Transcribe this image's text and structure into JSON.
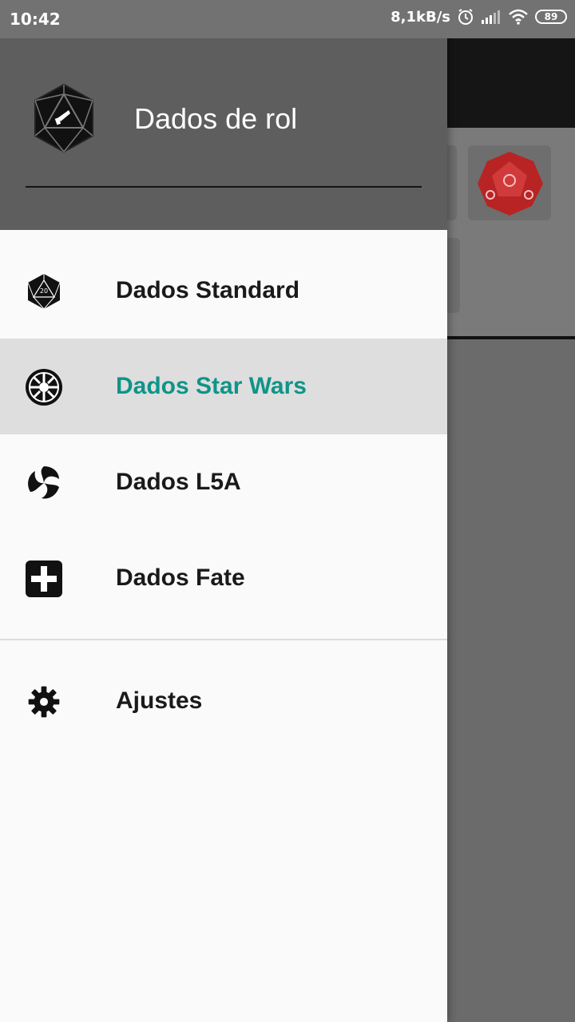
{
  "status_bar": {
    "time": "10:42",
    "network_speed": "8,1kB/s",
    "battery": "89",
    "icons": [
      "alarm-icon",
      "signal-icon",
      "wifi-icon",
      "battery-icon"
    ]
  },
  "drawer": {
    "header": {
      "title": "Dados de rol",
      "logo_icon": "d20-logo-icon"
    },
    "items": [
      {
        "label": "Dados Standard",
        "icon": "d20-icon",
        "selected": false
      },
      {
        "label": "Dados Star Wars",
        "icon": "imperial-emblem-icon",
        "selected": true
      },
      {
        "label": "Dados L5A",
        "icon": "mon-crest-icon",
        "selected": false
      },
      {
        "label": "Dados Fate",
        "icon": "plus-square-icon",
        "selected": false
      }
    ],
    "settings": {
      "label": "Ajustes",
      "icon": "gear-icon"
    }
  },
  "colors": {
    "header_bg": "#5e5e5e",
    "selected_text": "#0f9488",
    "selected_bg": "#dedede",
    "die_red": "#c92a2a"
  }
}
